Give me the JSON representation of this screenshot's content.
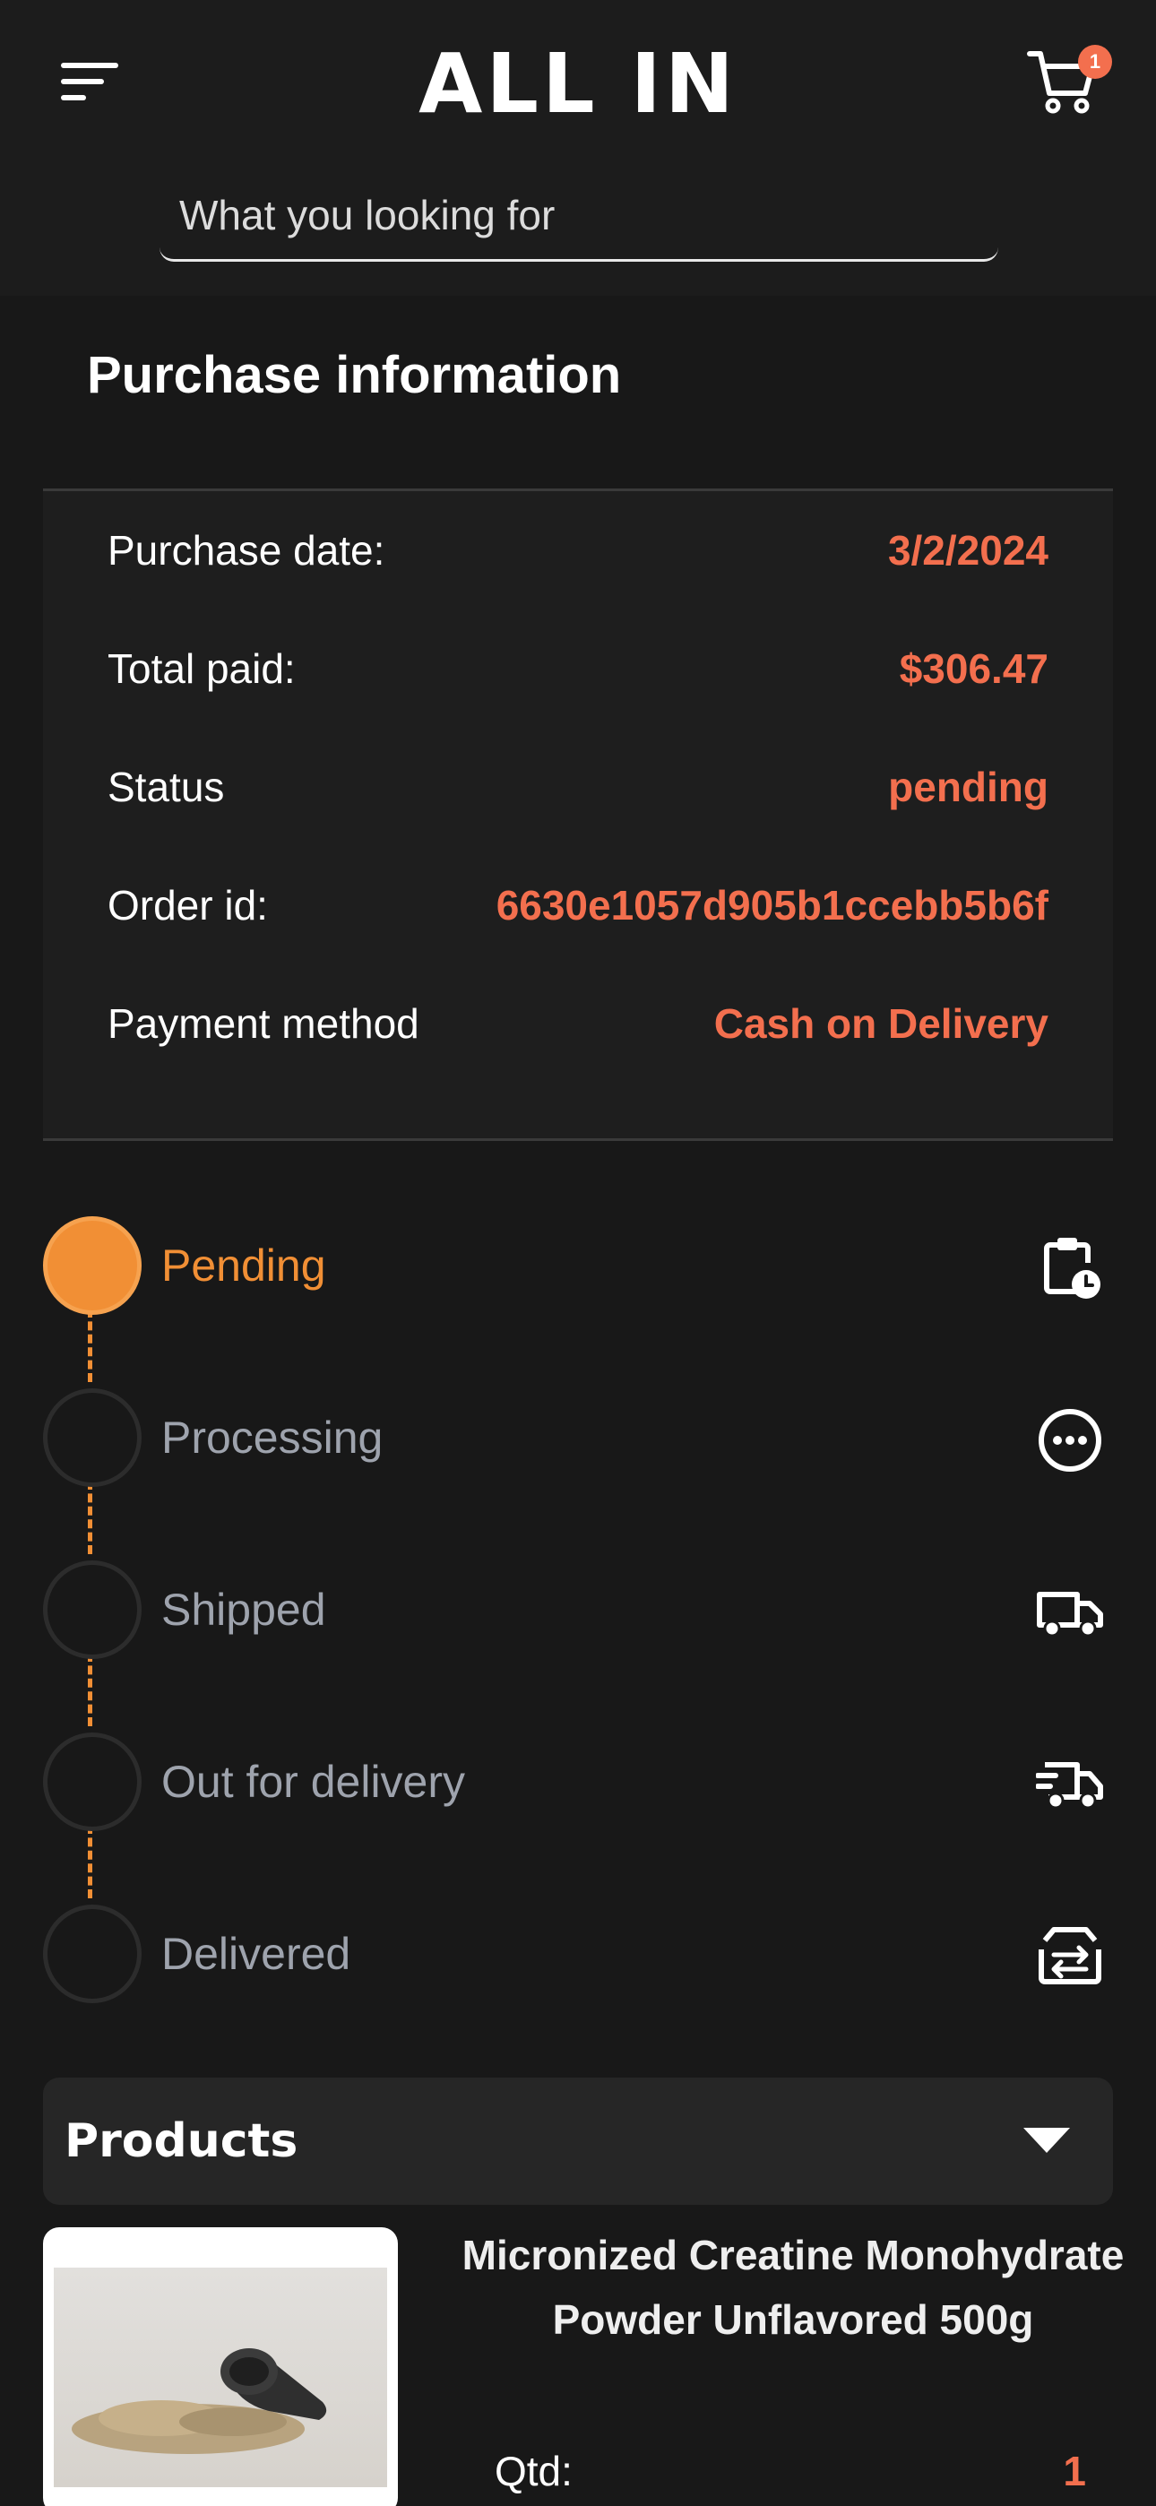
{
  "header": {
    "logo": "ALL IN",
    "cart_count": "1",
    "search_placeholder": "What you looking for"
  },
  "page_title": "Purchase information",
  "purchase_info": [
    {
      "label": "Purchase date:",
      "value": "3/2/2024"
    },
    {
      "label": "Total paid:",
      "value": "$306.47"
    },
    {
      "label": "Status",
      "value": "pending"
    },
    {
      "label": "Order id:",
      "value": "6630e1057d905b1ccebb5b6f"
    },
    {
      "label": "Payment method",
      "value": "Cash on Delivery"
    }
  ],
  "timeline": [
    {
      "label": "Pending",
      "icon": "clipboard-clock-icon",
      "active": true
    },
    {
      "label": "Processing",
      "icon": "ellipsis-circle-icon",
      "active": false
    },
    {
      "label": "Shipped",
      "icon": "truck-icon",
      "active": false
    },
    {
      "label": "Out for delivery",
      "icon": "fast-truck-icon",
      "active": false
    },
    {
      "label": "Delivered",
      "icon": "box-transfer-icon",
      "active": false
    }
  ],
  "products": {
    "title": "Products",
    "items": [
      {
        "name": "Micronized Creatine Monohydrate Powder Unflavored 500g",
        "qty_label": "Qtd:",
        "qty": "1"
      }
    ]
  },
  "colors": {
    "accent": "#f36f4e",
    "timeline_active": "#f18f35",
    "background": "#181818"
  }
}
